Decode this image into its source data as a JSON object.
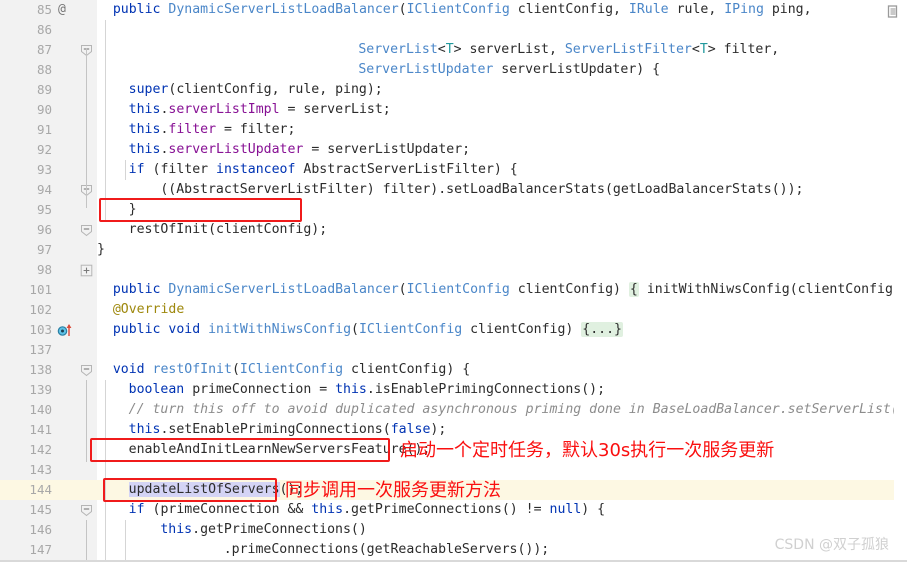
{
  "editor": {
    "language": "java",
    "accent_color": "#f01b1b",
    "keyword_color": "#0033b3",
    "class_color": "#4a86c8",
    "field_color": "#871094",
    "comment_color": "#8c8c8c",
    "annotation_color": "#9e880d",
    "current_line": 144
  },
  "lines": [
    {
      "num": "85",
      "gutter": "at",
      "code": "public DynamicServerListLoadBalancer(IClientConfig clientConfig, IRule rule, IPing ping,"
    },
    {
      "num": "86",
      "gutter": "",
      "code": ""
    },
    {
      "num": "87",
      "gutter": "fold-open",
      "code": "                                 ServerList<T> serverList, ServerListFilter<T> filter,"
    },
    {
      "num": "88",
      "gutter": "",
      "code": "                                 ServerListUpdater serverListUpdater) {"
    },
    {
      "num": "89",
      "gutter": "",
      "code": "    super(clientConfig, rule, ping);"
    },
    {
      "num": "90",
      "gutter": "",
      "code": "    this.serverListImpl = serverList;"
    },
    {
      "num": "91",
      "gutter": "",
      "code": "    this.filter = filter;"
    },
    {
      "num": "92",
      "gutter": "",
      "code": "    this.serverListUpdater = serverListUpdater;"
    },
    {
      "num": "93",
      "gutter": "",
      "code": "    if (filter instanceof AbstractServerListFilter) {"
    },
    {
      "num": "94",
      "gutter": "fold-open",
      "code": "        ((AbstractServerListFilter) filter).setLoadBalancerStats(getLoadBalancerStats());"
    },
    {
      "num": "95",
      "gutter": "",
      "code": "    }"
    },
    {
      "num": "96",
      "gutter": "fold-open",
      "code": "    restOfInit(clientConfig);"
    },
    {
      "num": "97",
      "gutter": "",
      "code": "}"
    },
    {
      "num": "98",
      "gutter": "fold-collapsed",
      "code": ""
    },
    {
      "num": "101",
      "gutter": "",
      "code": "public DynamicServerListLoadBalancer(IClientConfig clientConfig) { initWithNiwsConfig(clientConfig); }"
    },
    {
      "num": "102",
      "gutter": "",
      "code": "@Override"
    },
    {
      "num": "103",
      "gutter": "override",
      "code": "public void initWithNiwsConfig(IClientConfig clientConfig) {...}"
    },
    {
      "num": "137",
      "gutter": "",
      "code": ""
    },
    {
      "num": "138",
      "gutter": "fold-open",
      "code": "void restOfInit(IClientConfig clientConfig) {"
    },
    {
      "num": "139",
      "gutter": "",
      "code": "    boolean primeConnection = this.isEnablePrimingConnections();"
    },
    {
      "num": "140",
      "gutter": "",
      "code": "    // turn this off to avoid duplicated asynchronous priming done in BaseLoadBalancer.setServerList()"
    },
    {
      "num": "141",
      "gutter": "",
      "code": "    this.setEnablePrimingConnections(false);"
    },
    {
      "num": "142",
      "gutter": "",
      "code": "    enableAndInitLearnNewServersFeature();"
    },
    {
      "num": "143",
      "gutter": "",
      "code": ""
    },
    {
      "num": "144",
      "gutter": "",
      "code": "    updateListOfServers();"
    },
    {
      "num": "145",
      "gutter": "fold-open",
      "code": "    if (primeConnection && this.getPrimeConnections() != null) {"
    },
    {
      "num": "146",
      "gutter": "",
      "code": "        this.getPrimeConnections()"
    },
    {
      "num": "147",
      "gutter": "",
      "code": "                .primeConnections(getReachableServers());"
    }
  ],
  "code_tokens": {
    "l85": [
      {
        "t": "public ",
        "c": "kw"
      },
      {
        "t": "DynamicServerListLoadBalancer",
        "c": "cls"
      },
      {
        "t": "(",
        "c": "pln"
      },
      {
        "t": "IClientConfig",
        "c": "cls"
      },
      {
        "t": " clientConfig, ",
        "c": "pln"
      },
      {
        "t": "IRule",
        "c": "cls"
      },
      {
        "t": " rule, ",
        "c": "pln"
      },
      {
        "t": "IPing",
        "c": "cls"
      },
      {
        "t": " ping,",
        "c": "pln"
      }
    ],
    "l87": [
      {
        "t": "ServerList",
        "c": "cls"
      },
      {
        "t": "<",
        "c": "pln"
      },
      {
        "t": "T",
        "c": "gen"
      },
      {
        "t": "> serverList, ",
        "c": "pln"
      },
      {
        "t": "ServerListFilter",
        "c": "cls"
      },
      {
        "t": "<",
        "c": "pln"
      },
      {
        "t": "T",
        "c": "gen"
      },
      {
        "t": "> filter,",
        "c": "pln"
      }
    ],
    "l88": [
      {
        "t": "ServerListUpdater",
        "c": "cls"
      },
      {
        "t": " serverListUpdater) {",
        "c": "pln"
      }
    ],
    "l89": [
      {
        "t": "super",
        "c": "kw"
      },
      {
        "t": "(clientConfig, rule, ping);",
        "c": "pln"
      }
    ],
    "l90": [
      {
        "t": "this",
        "c": "kw"
      },
      {
        "t": ".",
        "c": "pln"
      },
      {
        "t": "serverListImpl",
        "c": "fld"
      },
      {
        "t": " = serverList;",
        "c": "pln"
      }
    ],
    "l91": [
      {
        "t": "this",
        "c": "kw"
      },
      {
        "t": ".",
        "c": "pln"
      },
      {
        "t": "filter",
        "c": "fld"
      },
      {
        "t": " = filter;",
        "c": "pln"
      }
    ],
    "l92": [
      {
        "t": "this",
        "c": "kw"
      },
      {
        "t": ".",
        "c": "pln"
      },
      {
        "t": "serverListUpdater",
        "c": "fld"
      },
      {
        "t": " = serverListUpdater;",
        "c": "pln"
      }
    ],
    "l93": [
      {
        "t": "if",
        "c": "kw"
      },
      {
        "t": " (filter ",
        "c": "pln"
      },
      {
        "t": "instanceof",
        "c": "kw"
      },
      {
        "t": " AbstractServerListFilter) {",
        "c": "pln"
      }
    ],
    "l94": [
      {
        "t": "((AbstractServerListFilter) filter).setLoadBalancerStats(getLoadBalancerStats());",
        "c": "pln"
      }
    ],
    "l95": [
      {
        "t": "}",
        "c": "pln"
      }
    ],
    "l96": [
      {
        "t": "restOfInit(clientConfig);",
        "c": "pln"
      }
    ],
    "l97": [
      {
        "t": "}",
        "c": "pln"
      }
    ],
    "l101": [
      {
        "t": "public ",
        "c": "kw"
      },
      {
        "t": "DynamicServerListLoadBalancer",
        "c": "cls"
      },
      {
        "t": "(",
        "c": "pln"
      },
      {
        "t": "IClientConfig",
        "c": "cls"
      },
      {
        "t": " clientConfig) ",
        "c": "pln"
      },
      {
        "t": "{",
        "c": "foldchip"
      },
      {
        "t": " initWithNiwsConfig(clientConfig); ",
        "c": "pln"
      },
      {
        "t": "}",
        "c": "foldchip"
      }
    ],
    "l102": [
      {
        "t": "@Override",
        "c": "anno"
      }
    ],
    "l103": [
      {
        "t": "public ",
        "c": "kw"
      },
      {
        "t": "void ",
        "c": "kw"
      },
      {
        "t": "initWithNiwsConfig",
        "c": "cls"
      },
      {
        "t": "(",
        "c": "pln"
      },
      {
        "t": "IClientConfig",
        "c": "cls"
      },
      {
        "t": " clientConfig) ",
        "c": "pln"
      },
      {
        "t": "{...}",
        "c": "foldchip"
      }
    ],
    "l138": [
      {
        "t": "void ",
        "c": "kw"
      },
      {
        "t": "restOfInit",
        "c": "cls"
      },
      {
        "t": "(",
        "c": "pln"
      },
      {
        "t": "IClientConfig",
        "c": "cls"
      },
      {
        "t": " clientConfig) {",
        "c": "pln"
      }
    ],
    "l139": [
      {
        "t": "boolean",
        "c": "kw"
      },
      {
        "t": " primeConnection = ",
        "c": "pln"
      },
      {
        "t": "this",
        "c": "kw"
      },
      {
        "t": ".isEnablePrimingConnections();",
        "c": "pln"
      }
    ],
    "l140": [
      {
        "t": "// turn this off to avoid duplicated asynchronous priming done in BaseLoadBalancer.setServerList()",
        "c": "cmt"
      }
    ],
    "l141": [
      {
        "t": "this",
        "c": "kw"
      },
      {
        "t": ".setEnablePrimingConnections(",
        "c": "pln"
      },
      {
        "t": "false",
        "c": "kw"
      },
      {
        "t": ");",
        "c": "pln"
      }
    ],
    "l142": [
      {
        "t": "enableAndInitLearnNewServersFeature();",
        "c": "pln"
      }
    ],
    "l144": [
      {
        "t": "updateListOfServers",
        "c": "sel"
      },
      {
        "t": "();",
        "c": "pln"
      }
    ],
    "l145": [
      {
        "t": "if",
        "c": "kw"
      },
      {
        "t": " (primeConnection && ",
        "c": "pln"
      },
      {
        "t": "this",
        "c": "kw"
      },
      {
        "t": ".getPrimeConnections() != ",
        "c": "pln"
      },
      {
        "t": "null",
        "c": "kw"
      },
      {
        "t": ") {",
        "c": "pln"
      }
    ],
    "l146": [
      {
        "t": "this",
        "c": "kw"
      },
      {
        "t": ".getPrimeConnections()",
        "c": "pln"
      }
    ],
    "l147": [
      {
        "t": ".primeConnections(getReachableServers());",
        "c": "pln"
      }
    ]
  },
  "annotations": [
    {
      "id": "box-restofinit",
      "label": "restOfInit(clientConfig);"
    },
    {
      "id": "box-enableandinit",
      "label": "enableAndInitLearnNewServersFeature();"
    },
    {
      "id": "box-updatelist",
      "label": "updateListOfServers();"
    }
  ],
  "notes": {
    "note1": "启动一个定时任务，默认30s执行一次服务更新",
    "note2": "同步调用一次服务更新方法"
  },
  "watermark": "CSDN @双子孤狼",
  "gutter_icons": {
    "at": "@",
    "override_tooltip": "overriding-method-icon"
  }
}
